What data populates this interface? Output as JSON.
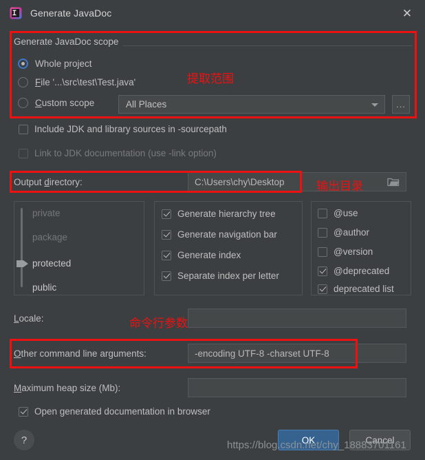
{
  "window": {
    "title": "Generate JavaDoc",
    "app_icon": "intellij-idea-icon",
    "close_label": "✕"
  },
  "scope": {
    "group_title": "Generate JavaDoc scope",
    "options": [
      {
        "label": "Whole project",
        "selected": true
      },
      {
        "label": "File '...\\src\\test\\Test.java'",
        "selected": false
      },
      {
        "label": "Custom scope",
        "selected": false
      }
    ],
    "custom_scope_value": "All Places",
    "browse_label": "...",
    "annotation": "提取范围"
  },
  "sources": {
    "include_jdk": {
      "label": "Include JDK and library sources in -sourcepath",
      "checked": false
    },
    "link_jdk": {
      "label": "Link to JDK documentation (use -link option)",
      "checked": false
    }
  },
  "output": {
    "label": "Output directory:",
    "label_mnemonic": "d",
    "value": "C:\\Users\\chy\\Desktop",
    "annotation": "输出目录",
    "browse_icon": "folder-icon"
  },
  "visibility": {
    "levels": [
      "private",
      "package",
      "protected",
      "public"
    ],
    "selected": "protected"
  },
  "generate_options": [
    {
      "label": "Generate hierarchy tree",
      "checked": true
    },
    {
      "label": "Generate navigation bar",
      "checked": true
    },
    {
      "label": "Generate index",
      "checked": true
    },
    {
      "label": "Separate index per letter",
      "checked": true
    }
  ],
  "tag_options": [
    {
      "label": "@use",
      "checked": false
    },
    {
      "label": "@author",
      "checked": false
    },
    {
      "label": "@version",
      "checked": false
    },
    {
      "label": "@deprecated",
      "checked": true
    },
    {
      "label": "deprecated list",
      "checked": true
    }
  ],
  "locale": {
    "label": "Locale:",
    "label_mnemonic": "L",
    "value": ""
  },
  "args": {
    "label": "Other command line arguments:",
    "label_mnemonic": "O",
    "value": "-encoding UTF-8 -charset UTF-8",
    "annotation": "命令行参数"
  },
  "heap": {
    "label": "Maximum heap size (Mb):",
    "label_mnemonic": "M",
    "value": ""
  },
  "open_browser": {
    "label": "Open generated documentation in browser",
    "checked": true
  },
  "buttons": {
    "ok": "OK",
    "cancel": "Cancel",
    "help": "?"
  },
  "watermark": "https://blog.csdn.net/chy_18883701161",
  "colors": {
    "accent": "#36628f",
    "annotation": "#ee1111",
    "background": "#3c3f41",
    "field": "#454849"
  }
}
